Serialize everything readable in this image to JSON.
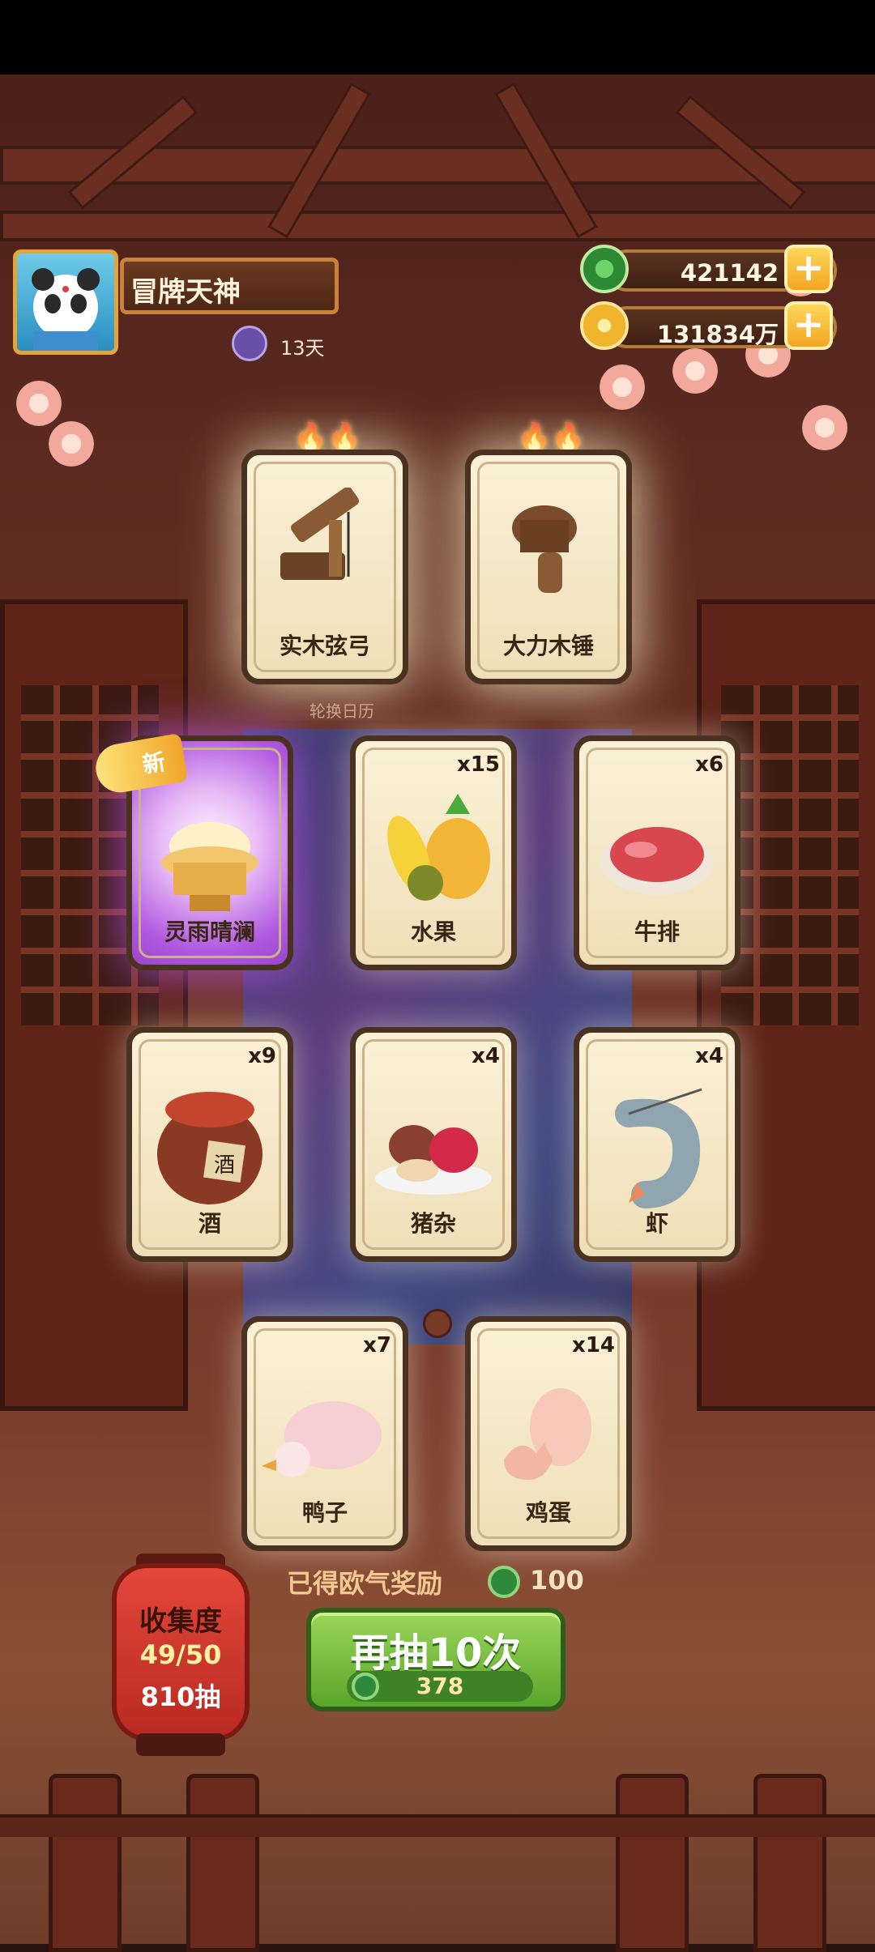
{
  "player": {
    "name": "冒牌天神",
    "streak_days": "13天"
  },
  "currency": {
    "jade": "421142",
    "coins": "131834万"
  },
  "rotate_label": "轮换日历",
  "featured_cards": [
    {
      "label": "实木弦弓",
      "art": "bow"
    },
    {
      "label": "大力木锤",
      "art": "hammer"
    }
  ],
  "cards": [
    {
      "label": "灵雨晴澜",
      "count": "",
      "art": "treasure",
      "badge": "新"
    },
    {
      "label": "水果",
      "count": "x15",
      "art": "fruit"
    },
    {
      "label": "牛排",
      "count": "x6",
      "art": "steak"
    },
    {
      "label": "酒",
      "count": "x9",
      "art": "wine"
    },
    {
      "label": "猪杂",
      "count": "x4",
      "art": "offal"
    },
    {
      "label": "虾",
      "count": "x4",
      "art": "shrimp"
    },
    {
      "label": "鸭子",
      "count": "x7",
      "art": "duck"
    },
    {
      "label": "鸡蛋",
      "count": "x14",
      "art": "egg"
    }
  ],
  "bonus": {
    "text": "已得欧气奖励",
    "value": "100"
  },
  "draw_button": {
    "label": "再抽10次",
    "cost": "378"
  },
  "collection": {
    "title": "收集度",
    "progress": "49/50",
    "draws": "810抽"
  },
  "wine_char": "酒"
}
